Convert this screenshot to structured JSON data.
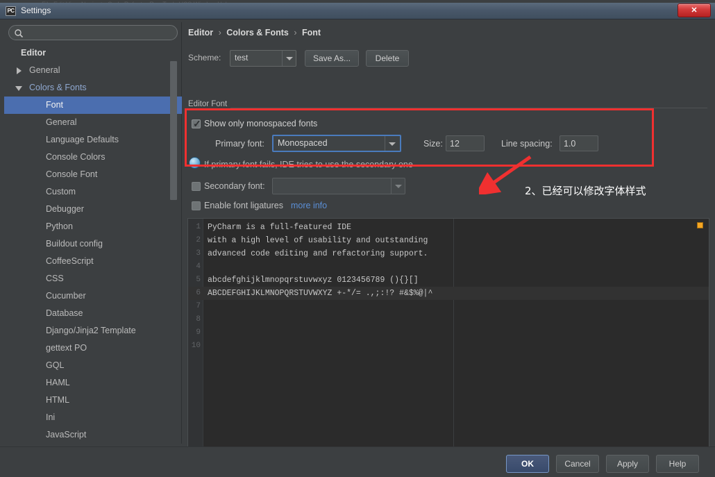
{
  "background_strip": {
    "menu_text": "File   Edit   View   Navigate   Code   Refactor   Run   Tools   VCS   Window   Help"
  },
  "window": {
    "title": "Settings",
    "icon": "pycharm-icon",
    "icon_text": "PC",
    "close_label": "✕"
  },
  "sidebar": {
    "search": {
      "value": "",
      "placeholder": ""
    },
    "items": [
      {
        "label": "Editor",
        "level": "root",
        "arrow": "none",
        "kind": "plain",
        "selected": false
      },
      {
        "label": "General",
        "level": "lvl1",
        "arrow": "collapsed",
        "kind": "plain",
        "selected": false
      },
      {
        "label": "Colors & Fonts",
        "level": "lvl1",
        "arrow": "expanded",
        "kind": "group",
        "selected": false
      },
      {
        "label": "Font",
        "level": "lvl2",
        "arrow": "none",
        "kind": "plain",
        "selected": true
      },
      {
        "label": "General",
        "level": "lvl2",
        "arrow": "none",
        "kind": "plain",
        "selected": false
      },
      {
        "label": "Language Defaults",
        "level": "lvl2",
        "arrow": "none",
        "kind": "plain",
        "selected": false
      },
      {
        "label": "Console Colors",
        "level": "lvl2",
        "arrow": "none",
        "kind": "plain",
        "selected": false
      },
      {
        "label": "Console Font",
        "level": "lvl2",
        "arrow": "none",
        "kind": "plain",
        "selected": false
      },
      {
        "label": "Custom",
        "level": "lvl2",
        "arrow": "none",
        "kind": "plain",
        "selected": false
      },
      {
        "label": "Debugger",
        "level": "lvl2",
        "arrow": "none",
        "kind": "plain",
        "selected": false
      },
      {
        "label": "Python",
        "level": "lvl2",
        "arrow": "none",
        "kind": "plain",
        "selected": false
      },
      {
        "label": "Buildout config",
        "level": "lvl2",
        "arrow": "none",
        "kind": "plain",
        "selected": false
      },
      {
        "label": "CoffeeScript",
        "level": "lvl2",
        "arrow": "none",
        "kind": "plain",
        "selected": false
      },
      {
        "label": "CSS",
        "level": "lvl2",
        "arrow": "none",
        "kind": "plain",
        "selected": false
      },
      {
        "label": "Cucumber",
        "level": "lvl2",
        "arrow": "none",
        "kind": "plain",
        "selected": false
      },
      {
        "label": "Database",
        "level": "lvl2",
        "arrow": "none",
        "kind": "plain",
        "selected": false
      },
      {
        "label": "Django/Jinja2 Template",
        "level": "lvl2",
        "arrow": "none",
        "kind": "plain",
        "selected": false
      },
      {
        "label": "gettext PO",
        "level": "lvl2",
        "arrow": "none",
        "kind": "plain",
        "selected": false
      },
      {
        "label": "GQL",
        "level": "lvl2",
        "arrow": "none",
        "kind": "plain",
        "selected": false
      },
      {
        "label": "HAML",
        "level": "lvl2",
        "arrow": "none",
        "kind": "plain",
        "selected": false
      },
      {
        "label": "HTML",
        "level": "lvl2",
        "arrow": "none",
        "kind": "plain",
        "selected": false
      },
      {
        "label": "Ini",
        "level": "lvl2",
        "arrow": "none",
        "kind": "plain",
        "selected": false
      },
      {
        "label": "JavaScript",
        "level": "lvl2",
        "arrow": "none",
        "kind": "plain",
        "selected": false
      }
    ]
  },
  "main": {
    "breadcrumb": {
      "part1": "Editor",
      "part2": "Colors & Fonts",
      "part3": "Font",
      "separator": "›"
    },
    "scheme": {
      "label": "Scheme:",
      "value": "test",
      "save_as_label": "Save As...",
      "delete_label": "Delete"
    },
    "editor_font": {
      "group_title": "Editor Font",
      "show_monospaced": {
        "label": "Show only monospaced fonts",
        "checked": true
      },
      "primary_font": {
        "label": "Primary font:",
        "value": "Monospaced"
      },
      "size": {
        "label": "Size:",
        "value": "12"
      },
      "line_spacing": {
        "label": "Line spacing:",
        "value": "1.0"
      },
      "info_text": "If primary font fails, IDE tries to use the secondary one",
      "secondary_font": {
        "label": "Secondary font:",
        "value": "",
        "checked": false
      },
      "ligatures": {
        "label": "Enable font ligatures",
        "link": "more info",
        "checked": false
      }
    },
    "preview": {
      "lines": [
        {
          "number": "1",
          "text": "PyCharm is a full-featured IDE",
          "current": false
        },
        {
          "number": "2",
          "text": "with a high level of usability and outstanding",
          "current": false
        },
        {
          "number": "3",
          "text": "advanced code editing and refactoring support.",
          "current": false
        },
        {
          "number": "4",
          "text": "",
          "current": false
        },
        {
          "number": "5",
          "text": "abcdefghijklmnopqrstuvwxyz 0123456789 (){}[]",
          "current": false
        },
        {
          "number": "6",
          "text": "ABCDEFGHIJKLMNOPQRSTUVWXYZ +-*/= .,;:!? #&$%@|^",
          "current": true
        },
        {
          "number": "7",
          "text": "",
          "current": false
        },
        {
          "number": "8",
          "text": "",
          "current": false
        },
        {
          "number": "9",
          "text": "",
          "current": false
        },
        {
          "number": "10",
          "text": "",
          "current": false
        }
      ]
    }
  },
  "annotation": {
    "text": "2、已经可以修改字体样式",
    "color": "#f03030"
  },
  "footer": {
    "ok": "OK",
    "cancel": "Cancel",
    "apply": "Apply",
    "help": "Help"
  },
  "colors": {
    "accent_selection": "#4b6eaf",
    "focus_border": "#4a7bbd",
    "annotation_red": "#f03030",
    "marker_orange": "#f5a623",
    "link_blue": "#5b8fd6",
    "panel_bg": "#3c3f41",
    "editor_bg": "#2b2b2b"
  }
}
